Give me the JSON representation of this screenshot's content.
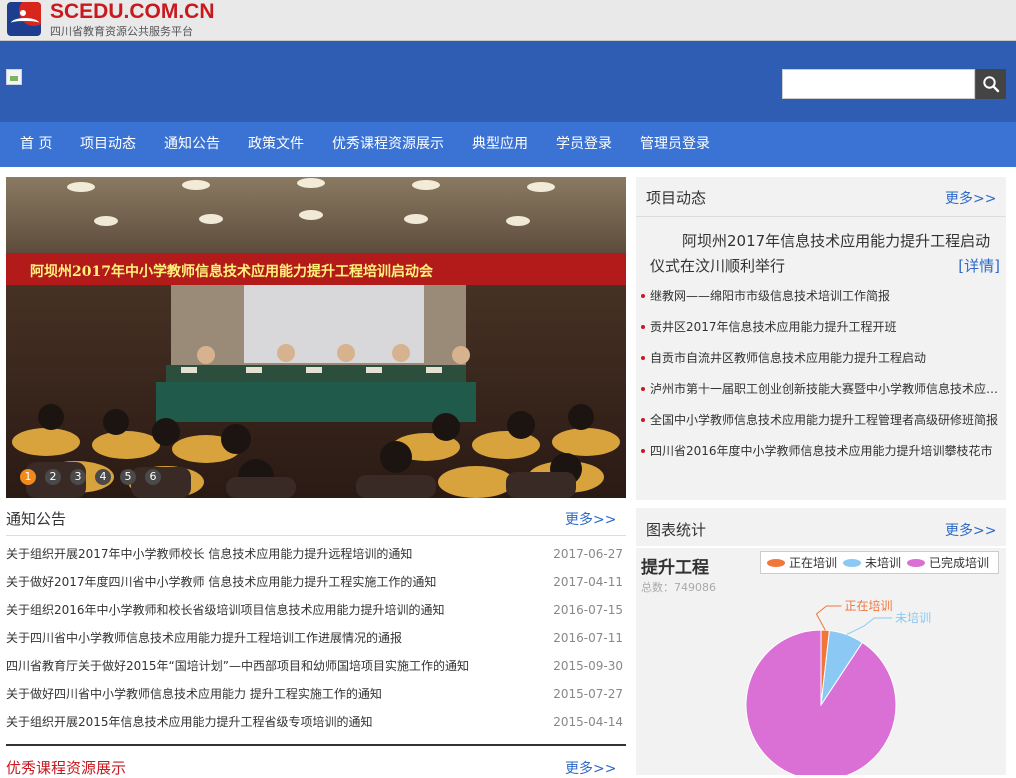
{
  "site": {
    "logo_title": "SCEDU.COM.CN",
    "logo_subtitle": "四川省教育资源公共服务平台"
  },
  "nav": {
    "items": [
      "首 页",
      "项目动态",
      "通知公告",
      "政策文件",
      "优秀课程资源展示",
      "典型应用",
      "学员登录",
      "管理员登录"
    ]
  },
  "slider": {
    "caption": "阿坝州2017年中小学教师信息技术应用能力提升工程培训启动会",
    "pages": [
      "1",
      "2",
      "3",
      "4",
      "5",
      "6"
    ],
    "active_page": "1"
  },
  "news": {
    "title": "项目动态",
    "more": "更多>>",
    "featured": "阿坝州2017年信息技术应用能力提升工程启动仪式在汶川顺利举行",
    "featured_link": "[详情]",
    "items": [
      "继教网——绵阳市市级信息技术培训工作简报",
      "贡井区2017年信息技术应用能力提升工程开班",
      "自贡市自流井区教师信息技术应用能力提升工程启动",
      "泸州市第十一届职工创业创新技能大赛暨中小学教师信息技术应用能力",
      "全国中小学教师信息技术应用能力提升工程管理者高级研修班简报",
      "四川省2016年度中小学教师信息技术应用能力提升培训攀枝花市"
    ]
  },
  "notices": {
    "title": "通知公告",
    "more": "更多>>",
    "items": [
      {
        "text": "关于组织开展2017年中小学教师校长 信息技术应用能力提升远程培训的通知",
        "date": "2017-06-27"
      },
      {
        "text": "关于做好2017年度四川省中小学教师 信息技术应用能力提升工程实施工作的通知",
        "date": "2017-04-11"
      },
      {
        "text": "关于组织2016年中小学教师和校长省级培训项目信息技术应用能力提升培训的通知",
        "date": "2016-07-15"
      },
      {
        "text": "关于四川省中小学教师信息技术应用能力提升工程培训工作进展情况的通报",
        "date": "2016-07-11"
      },
      {
        "text": "四川省教育厅关于做好2015年“国培计划”—中西部项目和幼师国培项目实施工作的通知",
        "date": "2015-09-30"
      },
      {
        "text": "关于做好四川省中小学教师信息技术应用能力 提升工程实施工作的通知",
        "date": "2015-07-27"
      },
      {
        "text": "关于组织开展2015年信息技术应用能力提升工程省级专项培训的通知",
        "date": "2015-04-14"
      }
    ]
  },
  "courses": {
    "title": "优秀课程资源展示",
    "more": "更多>>"
  },
  "stats": {
    "title": "图表统计",
    "more": "更多>>"
  },
  "chart_data": {
    "type": "pie",
    "title": "提升工程",
    "subtitle": "总数：749086",
    "total": 749086,
    "series": [
      {
        "name": "正在培训",
        "value": 1.8,
        "color": "#f0763c"
      },
      {
        "name": "未培训",
        "value": 7.5,
        "color": "#8cc8f4"
      },
      {
        "name": "已完成培训",
        "value": 90.7,
        "color": "#da70d6"
      }
    ]
  }
}
